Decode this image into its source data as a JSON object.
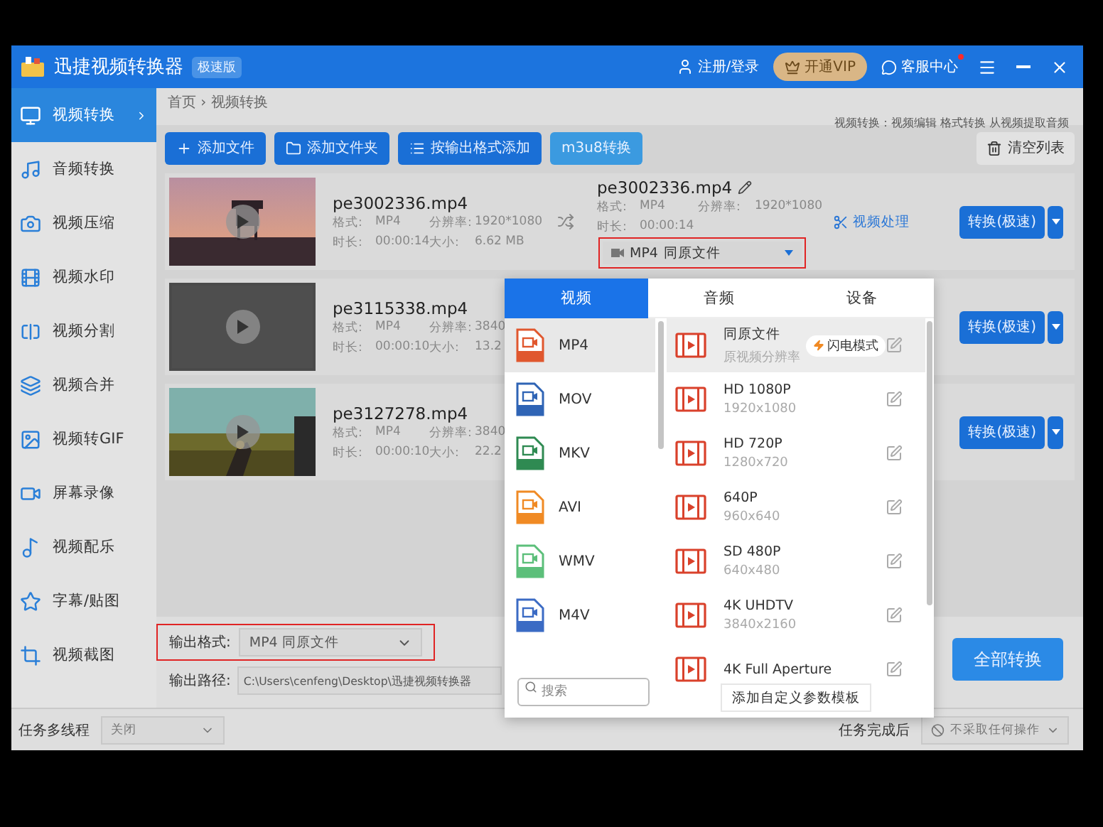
{
  "window": {
    "title": "迅捷视频转换器",
    "edition": "极速版",
    "login": "注册/登录",
    "vip": "开通VIP",
    "support": "客服中心",
    "support_notification": true
  },
  "sidebar": [
    {
      "label": "视频转换",
      "selected": true
    },
    {
      "label": "音频转换",
      "selected": false
    },
    {
      "label": "视频压缩",
      "selected": false
    },
    {
      "label": "视频水印",
      "selected": false
    },
    {
      "label": "视频分割",
      "selected": false
    },
    {
      "label": "视频合并",
      "selected": false
    },
    {
      "label": "视频转GIF",
      "selected": false
    },
    {
      "label": "屏幕录像",
      "selected": false
    },
    {
      "label": "视频配乐",
      "selected": false
    },
    {
      "label": "字幕/贴图",
      "selected": false
    },
    {
      "label": "视频截图",
      "selected": false
    }
  ],
  "breadcrumb": "首页 › 视频转换",
  "hint": "视频转换：视频编辑 格式转换 从视频提取音频",
  "toolbar": [
    {
      "label": "添加文件",
      "kind": "add"
    },
    {
      "label": "添加文件夹",
      "kind": "folder"
    },
    {
      "label": "按输出格式添加",
      "kind": "list"
    },
    {
      "label": "m3u8转换",
      "kind": "plain"
    }
  ],
  "clear_list": "清空列表",
  "files": [
    {
      "name": "pe3002336.mp4",
      "meta": [
        {
          "label": "格式:",
          "value": "MP4"
        },
        {
          "label": "分辨率:",
          "value": "1920*1080"
        },
        {
          "label": "时长:",
          "value": "00:00:14"
        },
        {
          "label": "大小:",
          "value": "6.62 MB"
        }
      ],
      "output": {
        "name": "pe3002336.mp4",
        "meta": [
          {
            "label": "格式:",
            "value": "MP4"
          },
          {
            "label": "分辨率:",
            "value": "1920*1080"
          },
          {
            "label": "时长:",
            "value": "00:00:14"
          }
        ],
        "format": "MP4",
        "preset": "同原文件"
      },
      "process": "视频处理",
      "convert": "转换(极速)"
    },
    {
      "name": "pe3115338.mp4",
      "meta": [
        {
          "label": "格式:",
          "value": "MP4"
        },
        {
          "label": "分辨率:",
          "value": "3840"
        },
        {
          "label": "时长:",
          "value": "00:00:10"
        },
        {
          "label": "大小:",
          "value": "13.2"
        }
      ],
      "convert": "转换(极速)"
    },
    {
      "name": "pe3127278.mp4",
      "meta": [
        {
          "label": "格式:",
          "value": "MP4"
        },
        {
          "label": "分辨率:",
          "value": "3840"
        },
        {
          "label": "时长:",
          "value": "00:00:10"
        },
        {
          "label": "大小:",
          "value": "22.2"
        }
      ],
      "convert": "转换(极速)"
    }
  ],
  "output_format": {
    "label": "输出格式:",
    "value": "MP4  同原文件"
  },
  "output_path": {
    "label": "输出路径:",
    "value": "C:\\Users\\cenfeng\\Desktop\\迅捷视频转换器"
  },
  "convert_all": "全部转换",
  "footer": {
    "threads_label": "任务多线程",
    "threads_value": "关闭",
    "after_label": "任务完成后",
    "after_value": "不采取任何操作"
  },
  "format_popup": {
    "tabs": [
      {
        "label": "视频",
        "selected": true
      },
      {
        "label": "音频",
        "selected": false
      },
      {
        "label": "设备",
        "selected": false
      }
    ],
    "formats": [
      {
        "label": "MP4",
        "selected": true,
        "color": "#e0572e"
      },
      {
        "label": "MOV",
        "selected": false,
        "color": "#2f64b5"
      },
      {
        "label": "MKV",
        "selected": false,
        "color": "#2f8a52"
      },
      {
        "label": "AVI",
        "selected": false,
        "color": "#f08a24"
      },
      {
        "label": "WMV",
        "selected": false,
        "color": "#5cbf7a"
      },
      {
        "label": "M4V",
        "selected": false,
        "color": "#3b6bc4"
      }
    ],
    "presets": [
      {
        "name": "同原文件",
        "detail": "原视频分辨率",
        "badge": "闪电模式",
        "selected": true
      },
      {
        "name": "HD 1080P",
        "detail": "1920x1080",
        "selected": false
      },
      {
        "name": "HD 720P",
        "detail": "1280x720",
        "selected": false
      },
      {
        "name": "640P",
        "detail": "960x640",
        "selected": false
      },
      {
        "name": "SD 480P",
        "detail": "640x480",
        "selected": false
      },
      {
        "name": "4K UHDTV",
        "detail": "3840x2160",
        "selected": false
      },
      {
        "name": "4K Full Aperture",
        "selected": false
      }
    ],
    "search_placeholder": "搜索",
    "add_template": "添加自定义参数模板"
  }
}
